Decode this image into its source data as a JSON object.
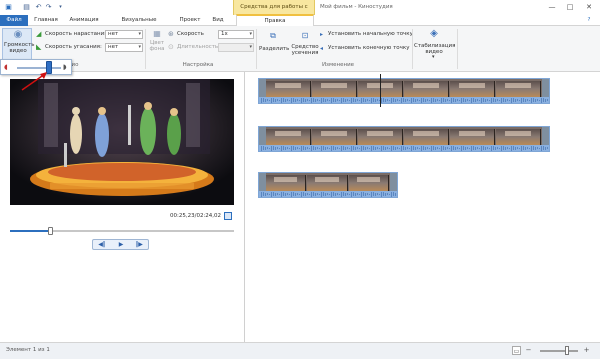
{
  "titlebar": {
    "context_header": "Средства для работы с видео",
    "app_title": "Мой фильм - Киностудия",
    "quick_access": [
      "save-icon",
      "undo-icon",
      "redo-icon",
      "dropdown-icon"
    ],
    "window_buttons": {
      "minimize": "—",
      "maximize": "□",
      "close": "✕"
    }
  },
  "tabs": [
    {
      "label": "Файл"
    },
    {
      "label": "Главная"
    },
    {
      "label": "Анимация"
    },
    {
      "label": "Визуальные эффекты"
    },
    {
      "label": "Проект"
    },
    {
      "label": "Вид"
    },
    {
      "label": "Правка"
    }
  ],
  "ribbon": {
    "volume_label": "Громкость видео",
    "fade_in_label": "Скорость нарастания:",
    "fade_in_value": "нет",
    "fade_out_label": "Скорость угасания:",
    "fade_out_value": "нет",
    "bg_color_label": "Цвет фона",
    "speed_label": "Скорость",
    "speed_value": "1x",
    "duration_label": "Длительность",
    "split_label": "Разделить",
    "trim_tool_label": "Средство усечения",
    "set_start_label": "Установить начальную точку",
    "set_end_label": "Установить конечную точку",
    "stabilization_label": "Стабилизация видео",
    "groups": {
      "audio_partial": "ио",
      "settings": "Настройка",
      "editing": "Изменение"
    }
  },
  "volume": {
    "level": 0.73
  },
  "preview": {
    "time_readout": "00:25,23/02:24,02",
    "seek_progress": 0.18,
    "transport": {
      "prev": "◀‖",
      "play": "▶",
      "next": "‖▶"
    }
  },
  "timeline": {
    "clips": [
      {
        "frames": 6,
        "playhead": true
      },
      {
        "frames": 6,
        "playhead": false
      },
      {
        "frames": 3,
        "playhead": false
      }
    ]
  },
  "statusbar": {
    "text": "Элемент 1 из 1",
    "zoom_out": "−",
    "zoom_in": "+",
    "zoom_level": 0.7
  },
  "colors": {
    "accent": "#2c6fbe",
    "context_tab": "#f8e7a0",
    "audio_wave": "#8ab0e0"
  }
}
